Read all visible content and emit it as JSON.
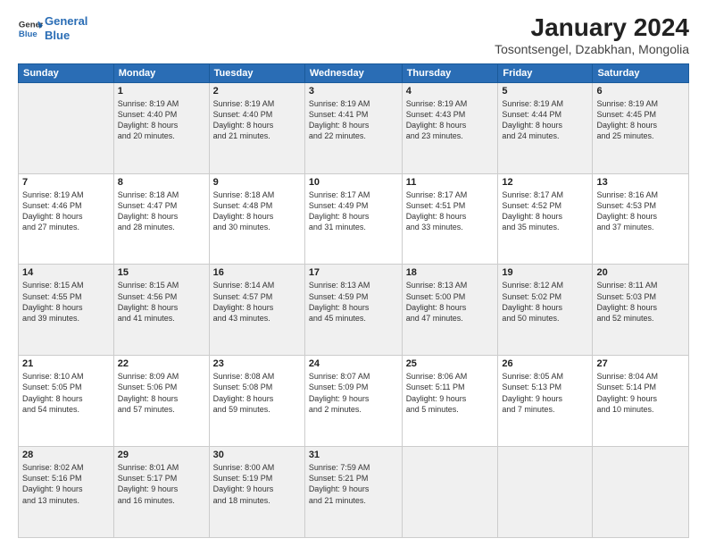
{
  "logo": {
    "line1": "General",
    "line2": "Blue"
  },
  "title": "January 2024",
  "subtitle": "Tosontsengel, Dzabkhan, Mongolia",
  "weekdays": [
    "Sunday",
    "Monday",
    "Tuesday",
    "Wednesday",
    "Thursday",
    "Friday",
    "Saturday"
  ],
  "weeks": [
    [
      {
        "day": "",
        "info": ""
      },
      {
        "day": "1",
        "info": "Sunrise: 8:19 AM\nSunset: 4:40 PM\nDaylight: 8 hours\nand 20 minutes."
      },
      {
        "day": "2",
        "info": "Sunrise: 8:19 AM\nSunset: 4:40 PM\nDaylight: 8 hours\nand 21 minutes."
      },
      {
        "day": "3",
        "info": "Sunrise: 8:19 AM\nSunset: 4:41 PM\nDaylight: 8 hours\nand 22 minutes."
      },
      {
        "day": "4",
        "info": "Sunrise: 8:19 AM\nSunset: 4:43 PM\nDaylight: 8 hours\nand 23 minutes."
      },
      {
        "day": "5",
        "info": "Sunrise: 8:19 AM\nSunset: 4:44 PM\nDaylight: 8 hours\nand 24 minutes."
      },
      {
        "day": "6",
        "info": "Sunrise: 8:19 AM\nSunset: 4:45 PM\nDaylight: 8 hours\nand 25 minutes."
      }
    ],
    [
      {
        "day": "7",
        "info": "Sunrise: 8:19 AM\nSunset: 4:46 PM\nDaylight: 8 hours\nand 27 minutes."
      },
      {
        "day": "8",
        "info": "Sunrise: 8:18 AM\nSunset: 4:47 PM\nDaylight: 8 hours\nand 28 minutes."
      },
      {
        "day": "9",
        "info": "Sunrise: 8:18 AM\nSunset: 4:48 PM\nDaylight: 8 hours\nand 30 minutes."
      },
      {
        "day": "10",
        "info": "Sunrise: 8:17 AM\nSunset: 4:49 PM\nDaylight: 8 hours\nand 31 minutes."
      },
      {
        "day": "11",
        "info": "Sunrise: 8:17 AM\nSunset: 4:51 PM\nDaylight: 8 hours\nand 33 minutes."
      },
      {
        "day": "12",
        "info": "Sunrise: 8:17 AM\nSunset: 4:52 PM\nDaylight: 8 hours\nand 35 minutes."
      },
      {
        "day": "13",
        "info": "Sunrise: 8:16 AM\nSunset: 4:53 PM\nDaylight: 8 hours\nand 37 minutes."
      }
    ],
    [
      {
        "day": "14",
        "info": "Sunrise: 8:15 AM\nSunset: 4:55 PM\nDaylight: 8 hours\nand 39 minutes."
      },
      {
        "day": "15",
        "info": "Sunrise: 8:15 AM\nSunset: 4:56 PM\nDaylight: 8 hours\nand 41 minutes."
      },
      {
        "day": "16",
        "info": "Sunrise: 8:14 AM\nSunset: 4:57 PM\nDaylight: 8 hours\nand 43 minutes."
      },
      {
        "day": "17",
        "info": "Sunrise: 8:13 AM\nSunset: 4:59 PM\nDaylight: 8 hours\nand 45 minutes."
      },
      {
        "day": "18",
        "info": "Sunrise: 8:13 AM\nSunset: 5:00 PM\nDaylight: 8 hours\nand 47 minutes."
      },
      {
        "day": "19",
        "info": "Sunrise: 8:12 AM\nSunset: 5:02 PM\nDaylight: 8 hours\nand 50 minutes."
      },
      {
        "day": "20",
        "info": "Sunrise: 8:11 AM\nSunset: 5:03 PM\nDaylight: 8 hours\nand 52 minutes."
      }
    ],
    [
      {
        "day": "21",
        "info": "Sunrise: 8:10 AM\nSunset: 5:05 PM\nDaylight: 8 hours\nand 54 minutes."
      },
      {
        "day": "22",
        "info": "Sunrise: 8:09 AM\nSunset: 5:06 PM\nDaylight: 8 hours\nand 57 minutes."
      },
      {
        "day": "23",
        "info": "Sunrise: 8:08 AM\nSunset: 5:08 PM\nDaylight: 8 hours\nand 59 minutes."
      },
      {
        "day": "24",
        "info": "Sunrise: 8:07 AM\nSunset: 5:09 PM\nDaylight: 9 hours\nand 2 minutes."
      },
      {
        "day": "25",
        "info": "Sunrise: 8:06 AM\nSunset: 5:11 PM\nDaylight: 9 hours\nand 5 minutes."
      },
      {
        "day": "26",
        "info": "Sunrise: 8:05 AM\nSunset: 5:13 PM\nDaylight: 9 hours\nand 7 minutes."
      },
      {
        "day": "27",
        "info": "Sunrise: 8:04 AM\nSunset: 5:14 PM\nDaylight: 9 hours\nand 10 minutes."
      }
    ],
    [
      {
        "day": "28",
        "info": "Sunrise: 8:02 AM\nSunset: 5:16 PM\nDaylight: 9 hours\nand 13 minutes."
      },
      {
        "day": "29",
        "info": "Sunrise: 8:01 AM\nSunset: 5:17 PM\nDaylight: 9 hours\nand 16 minutes."
      },
      {
        "day": "30",
        "info": "Sunrise: 8:00 AM\nSunset: 5:19 PM\nDaylight: 9 hours\nand 18 minutes."
      },
      {
        "day": "31",
        "info": "Sunrise: 7:59 AM\nSunset: 5:21 PM\nDaylight: 9 hours\nand 21 minutes."
      },
      {
        "day": "",
        "info": ""
      },
      {
        "day": "",
        "info": ""
      },
      {
        "day": "",
        "info": ""
      }
    ]
  ]
}
